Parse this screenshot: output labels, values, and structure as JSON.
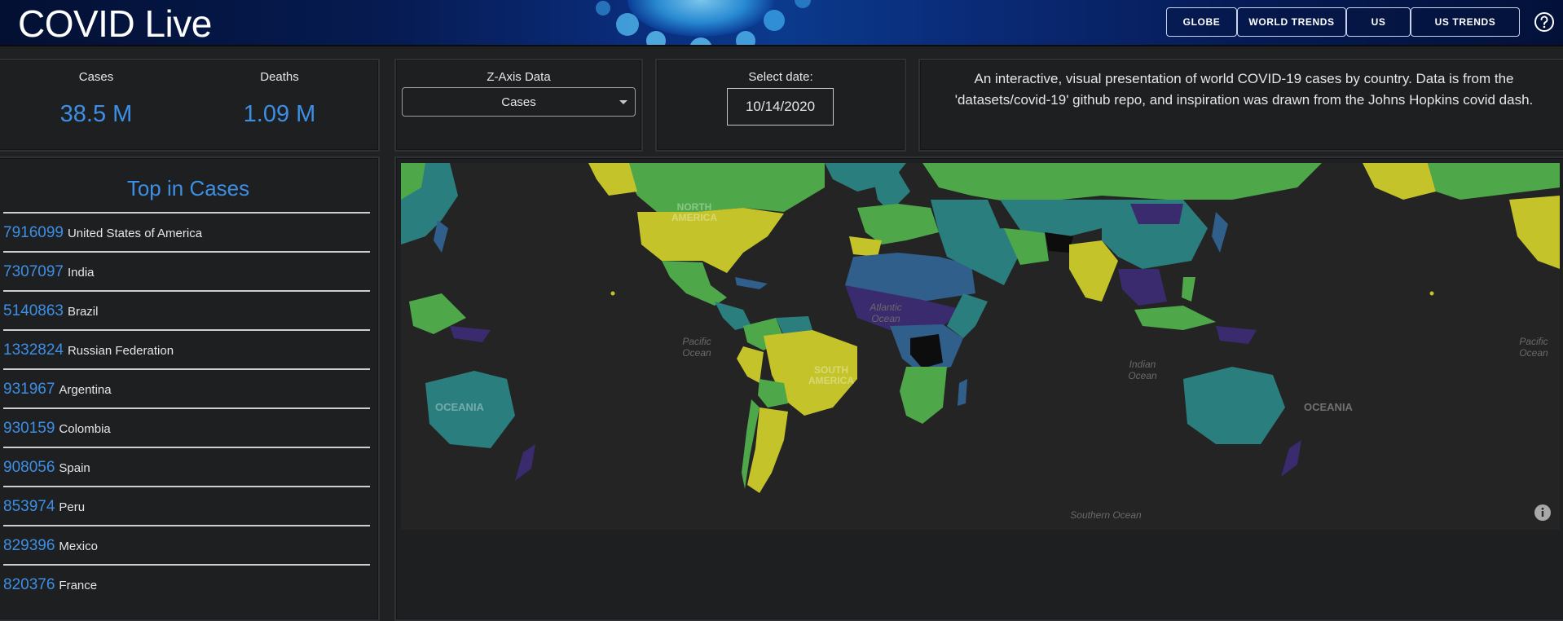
{
  "header": {
    "title": "COVID Live",
    "nav": [
      {
        "label": "GLOBE"
      },
      {
        "label": "WORLD TRENDS"
      },
      {
        "label": "US"
      },
      {
        "label": "US TRENDS"
      }
    ],
    "help_icon": "help-circle-icon"
  },
  "stats": {
    "cases_label": "Cases",
    "cases_value": "38.5 M",
    "deaths_label": "Deaths",
    "deaths_value": "1.09 M"
  },
  "zaxis": {
    "label": "Z-Axis Data",
    "selected": "Cases"
  },
  "date": {
    "label": "Select date:",
    "value": "10/14/2020"
  },
  "description": "An interactive, visual presentation of world COVID-19 cases by country. Data is from the 'datasets/covid-19' github repo, and inspiration was drawn from the Johns Hopkins covid dash.",
  "top_list": {
    "title": "Top in Cases",
    "items": [
      {
        "value": "7916099",
        "country": "United States of America"
      },
      {
        "value": "7307097",
        "country": "India"
      },
      {
        "value": "5140863",
        "country": "Brazil"
      },
      {
        "value": "1332824",
        "country": "Russian Federation"
      },
      {
        "value": "931967",
        "country": "Argentina"
      },
      {
        "value": "930159",
        "country": "Colombia"
      },
      {
        "value": "908056",
        "country": "Spain"
      },
      {
        "value": "853974",
        "country": "Peru"
      },
      {
        "value": "829396",
        "country": "Mexico"
      },
      {
        "value": "820376",
        "country": "France"
      }
    ]
  },
  "map": {
    "labels": {
      "north_america": "NORTH AMERICA",
      "south_america": "SOUTH AMERICA",
      "oceania": "OCEANIA",
      "atlantic": "Atlantic Ocean",
      "pacific": "Pacific Ocean",
      "indian": "Indian Ocean",
      "southern": "Southern Ocean"
    },
    "colors": {
      "water": "#242424",
      "high": "#c4c42a",
      "mid_high": "#4ea84a",
      "mid": "#2a7f7e",
      "low": "#2f5f8a",
      "lowest": "#3a2a6e",
      "none": "#0d0d0d"
    },
    "info_icon": "info-icon"
  },
  "colors": {
    "accent": "#3d8fe6",
    "panel_bg": "#1d1f21",
    "header_bg": "#0a2c7a"
  }
}
